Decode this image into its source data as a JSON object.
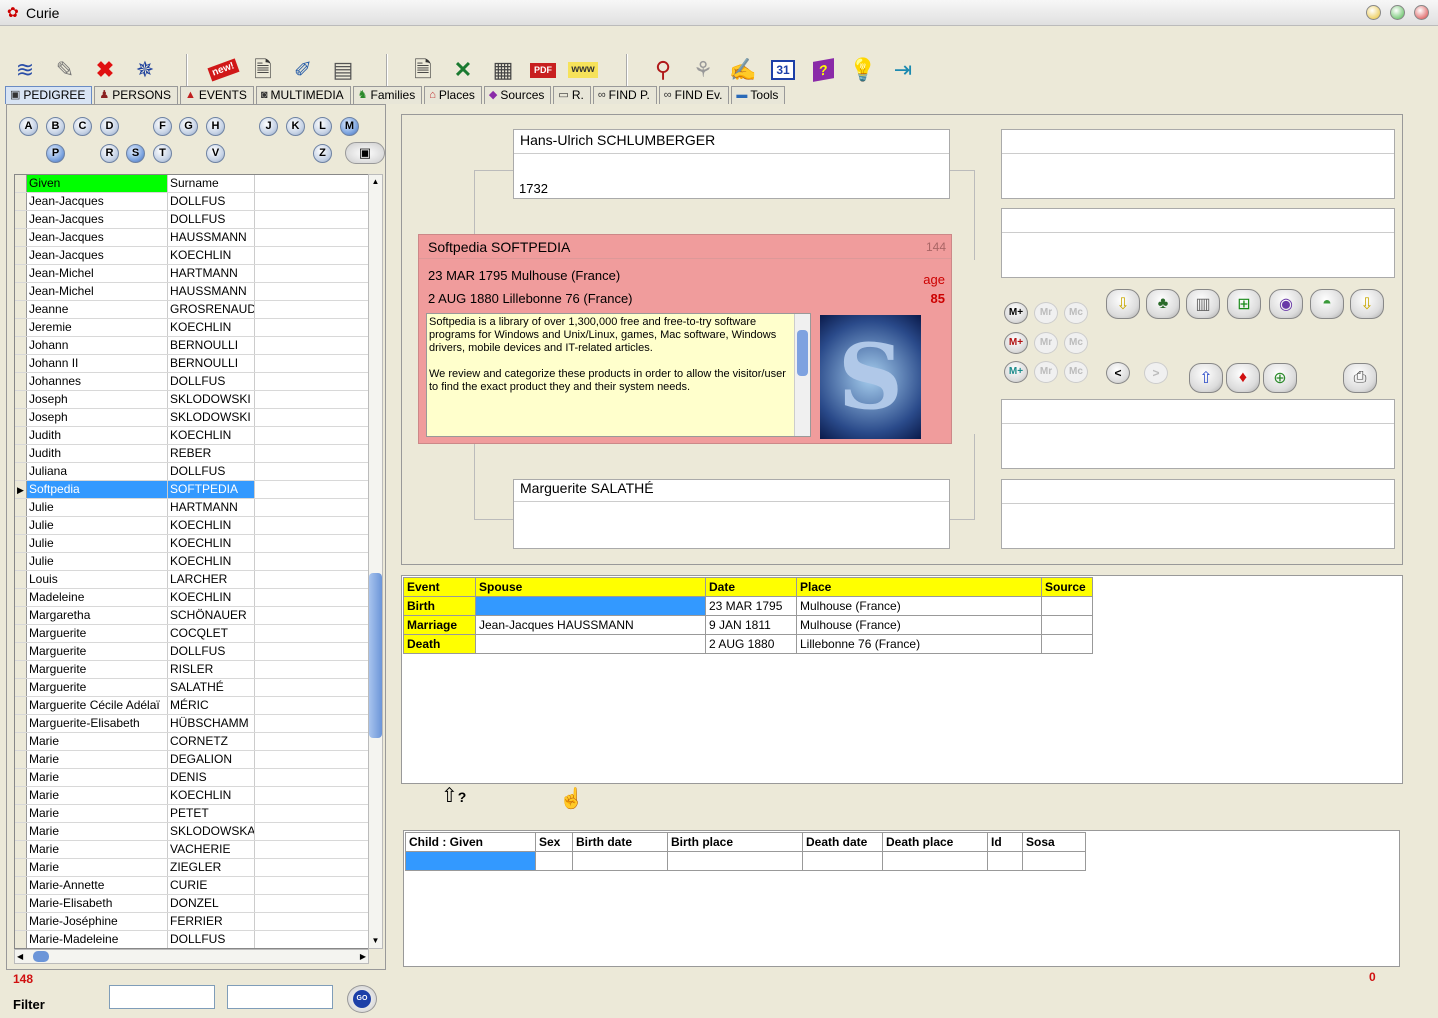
{
  "window": {
    "title": "Curie"
  },
  "toolbar": {
    "icons": [
      "arrange-icon",
      "edit-icon",
      "delete-icon",
      "compass-icon",
      "new-icon",
      "gedcom-import-icon",
      "edit-doc-icon",
      "report-icon",
      "gedcom-export-icon",
      "xls-export-icon",
      "html-export-icon",
      "pdf-export-icon",
      "www-export-icon",
      "search-icon",
      "genealogy-icon",
      "notes-icon",
      "calendar-icon",
      "help-book-icon",
      "tip-icon",
      "exit-icon"
    ],
    "new_label": "new!",
    "pdf_label": "PDF",
    "www_label": "www",
    "calendar_label": "31",
    "help_label": "?"
  },
  "tabs": [
    {
      "label": "PEDIGREE"
    },
    {
      "label": "PERSONS"
    },
    {
      "label": "EVENTS"
    },
    {
      "label": "MULTIMEDIA"
    },
    {
      "label": "Families"
    },
    {
      "label": "Places"
    },
    {
      "label": "Sources"
    },
    {
      "label": "R."
    },
    {
      "label": "FIND P."
    },
    {
      "label": "FIND Ev."
    },
    {
      "label": "Tools"
    }
  ],
  "letters_row1": [
    "A",
    "B",
    "C",
    "D",
    "F",
    "G",
    "H",
    "J",
    "K",
    "L",
    "M"
  ],
  "letters_row2": [
    "P",
    "R",
    "S",
    "T",
    "V",
    "Z"
  ],
  "grid": {
    "col_given": "Given",
    "col_surname": "Surname",
    "rows": [
      [
        "Jean-Jacques",
        "DOLLFUS"
      ],
      [
        "Jean-Jacques",
        "DOLLFUS"
      ],
      [
        "Jean-Jacques",
        "HAUSSMANN"
      ],
      [
        "Jean-Jacques",
        "KOECHLIN"
      ],
      [
        "Jean-Michel",
        "HARTMANN"
      ],
      [
        "Jean-Michel",
        "HAUSSMANN"
      ],
      [
        "Jeanne",
        "GROSRENAUD"
      ],
      [
        "Jeremie",
        "KOECHLIN"
      ],
      [
        "Johann",
        "BERNOULLI"
      ],
      [
        "Johann II",
        "BERNOULLI"
      ],
      [
        "Johannes",
        "DOLLFUS"
      ],
      [
        "Joseph",
        "SKLODOWSKI"
      ],
      [
        "Joseph",
        "SKLODOWSKI"
      ],
      [
        "Judith",
        "KOECHLIN"
      ],
      [
        "Judith",
        "REBER"
      ],
      [
        "Juliana",
        "DOLLFUS"
      ],
      [
        "Softpedia",
        "SOFTPEDIA"
      ],
      [
        "Julie",
        "HARTMANN"
      ],
      [
        "Julie",
        "KOECHLIN"
      ],
      [
        "Julie",
        "KOECHLIN"
      ],
      [
        "Julie",
        "KOECHLIN"
      ],
      [
        "Louis",
        "LARCHER"
      ],
      [
        "Madeleine",
        "KOECHLIN"
      ],
      [
        "Margaretha",
        "SCHÖNAUER"
      ],
      [
        "Marguerite",
        "COCQLET"
      ],
      [
        "Marguerite",
        "DOLLFUS"
      ],
      [
        "Marguerite",
        "RISLER"
      ],
      [
        "Marguerite",
        "SALATHÉ"
      ],
      [
        "Marguerite Cécile Adélaï",
        "MÉRIC"
      ],
      [
        "Marguerite-Elisabeth",
        "HÜBSCHAMM"
      ],
      [
        "Marie",
        "CORNETZ"
      ],
      [
        "Marie",
        "DEGALION"
      ],
      [
        "Marie",
        "DENIS"
      ],
      [
        "Marie",
        "KOECHLIN"
      ],
      [
        "Marie",
        "PETET"
      ],
      [
        "Marie",
        "SKLODOWSKA"
      ],
      [
        "Marie",
        "VACHERIE"
      ],
      [
        "Marie",
        "ZIEGLER"
      ],
      [
        "Marie-Annette",
        "CURIE"
      ],
      [
        "Marie-Elisabeth",
        "DONZEL"
      ],
      [
        "Marie-Joséphine",
        "FERRIER"
      ],
      [
        "Marie-Madeleine",
        "DOLLFUS"
      ]
    ],
    "selected_row_marker": "▶"
  },
  "count_left": "148",
  "filter": {
    "label": "Filter",
    "go": "GO"
  },
  "pedigree": {
    "father": {
      "name": "Hans-Ulrich   SCHLUMBERGER",
      "year": "1732"
    },
    "mother": {
      "name": "Marguerite   SALATHÉ"
    },
    "person": {
      "name": "Softpedia   SOFTPEDIA",
      "id": "144",
      "birth": "23 MAR 1795   Mulhouse (France)",
      "death": "2 AUG 1880   Lillebonne 76 (France)",
      "age_label": "age",
      "age": "85",
      "note": "Softpedia is a library of over 1,300,000 free and free-to-try software programs for Windows and Unix/Linux, games, Mac software, Windows drivers, mobile devices and IT-related articles.\n\nWe review and categorize these products in order to allow the visitor/user to find the exact product they and their system needs.",
      "photo_letter": "S"
    },
    "mbuttons": [
      "M+",
      "Mr",
      "Mc"
    ],
    "nav_prev": "<",
    "nav_next": ">"
  },
  "events": {
    "headers": [
      "Event",
      "Spouse",
      "Date",
      "Place",
      "Source"
    ],
    "rows": [
      [
        "Birth",
        "",
        "23 MAR 1795",
        "Mulhouse (France)",
        ""
      ],
      [
        "Marriage",
        "Jean-Jacques   HAUSSMANN",
        "9 JAN 1811",
        "Mulhouse (France)",
        ""
      ],
      [
        "Death",
        "",
        "2 AUG 1880",
        "Lillebonne 76 (France)",
        ""
      ]
    ]
  },
  "children": {
    "headers": [
      "Child : Given",
      "Sex",
      "Birth date",
      "Birth place",
      "Death date",
      "Death place",
      "Id",
      "Sosa"
    ]
  },
  "count_right": "0",
  "colors": {
    "accent_person": "#f09c9c",
    "note_bg": "#ffffcc",
    "header_yellow": "#ffff00",
    "given_header": "#00ff00",
    "selection": "#3399ff"
  }
}
